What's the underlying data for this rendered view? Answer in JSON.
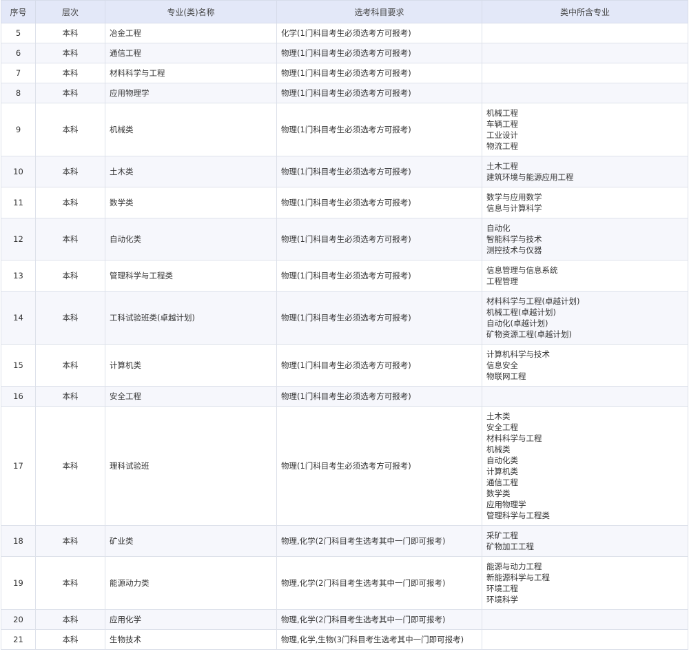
{
  "headers": [
    "序号",
    "层次",
    "专业(类)名称",
    "选考科目要求",
    "类中所含专业"
  ],
  "rows": [
    {
      "no": "5",
      "level": "本科",
      "name": "冶金工程",
      "req": "化学(1门科目考生必须选考方可报考)",
      "subs": []
    },
    {
      "no": "6",
      "level": "本科",
      "name": "通信工程",
      "req": "物理(1门科目考生必须选考方可报考)",
      "subs": []
    },
    {
      "no": "7",
      "level": "本科",
      "name": "材料科学与工程",
      "req": "物理(1门科目考生必须选考方可报考)",
      "subs": []
    },
    {
      "no": "8",
      "level": "本科",
      "name": "应用物理学",
      "req": "物理(1门科目考生必须选考方可报考)",
      "subs": []
    },
    {
      "no": "9",
      "level": "本科",
      "name": "机械类",
      "req": "物理(1门科目考生必须选考方可报考)",
      "subs": [
        "机械工程",
        "车辆工程",
        "工业设计",
        "物流工程"
      ]
    },
    {
      "no": "10",
      "level": "本科",
      "name": "土木类",
      "req": "物理(1门科目考生必须选考方可报考)",
      "subs": [
        "土木工程",
        "建筑环境与能源应用工程"
      ]
    },
    {
      "no": "11",
      "level": "本科",
      "name": "数学类",
      "req": "物理(1门科目考生必须选考方可报考)",
      "subs": [
        "数学与应用数学",
        "信息与计算科学"
      ]
    },
    {
      "no": "12",
      "level": "本科",
      "name": "自动化类",
      "req": "物理(1门科目考生必须选考方可报考)",
      "subs": [
        "自动化",
        "智能科学与技术",
        "测控技术与仪器"
      ]
    },
    {
      "no": "13",
      "level": "本科",
      "name": "管理科学与工程类",
      "req": "物理(1门科目考生必须选考方可报考)",
      "subs": [
        "信息管理与信息系统",
        "工程管理"
      ]
    },
    {
      "no": "14",
      "level": "本科",
      "name": "工科试验班类(卓越计划)",
      "req": "物理(1门科目考生必须选考方可报考)",
      "subs": [
        "材料科学与工程(卓越计划)",
        "机械工程(卓越计划)",
        "自动化(卓越计划)",
        "矿物资源工程(卓越计划)"
      ]
    },
    {
      "no": "15",
      "level": "本科",
      "name": "计算机类",
      "req": "物理(1门科目考生必须选考方可报考)",
      "subs": [
        "计算机科学与技术",
        "信息安全",
        "物联网工程"
      ]
    },
    {
      "no": "16",
      "level": "本科",
      "name": "安全工程",
      "req": "物理(1门科目考生必须选考方可报考)",
      "subs": []
    },
    {
      "no": "17",
      "level": "本科",
      "name": "理科试验班",
      "req": "物理(1门科目考生必须选考方可报考)",
      "subs": [
        "土木类",
        "安全工程",
        "材料科学与工程",
        "机械类",
        "自动化类",
        "计算机类",
        "通信工程",
        "数学类",
        "应用物理学",
        "管理科学与工程类"
      ]
    },
    {
      "no": "18",
      "level": "本科",
      "name": "矿业类",
      "req": "物理,化学(2门科目考生选考其中一门即可报考)",
      "subs": [
        "采矿工程",
        "矿物加工工程"
      ]
    },
    {
      "no": "19",
      "level": "本科",
      "name": "能源动力类",
      "req": "物理,化学(2门科目考生选考其中一门即可报考)",
      "subs": [
        "能源与动力工程",
        "新能源科学与工程",
        "环境工程",
        "环境科学"
      ]
    },
    {
      "no": "20",
      "level": "本科",
      "name": "应用化学",
      "req": "物理,化学(2门科目考生选考其中一门即可报考)",
      "subs": []
    },
    {
      "no": "21",
      "level": "本科",
      "name": "生物技术",
      "req": "物理,化学,生物(3门科目考生选考其中一门即可报考)",
      "subs": []
    }
  ]
}
